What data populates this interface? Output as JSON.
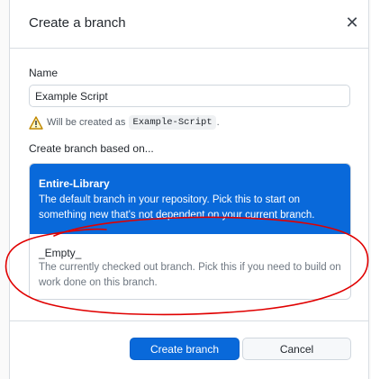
{
  "dialog": {
    "title": "Create a branch",
    "close_icon": "close-icon",
    "name_label": "Name",
    "name_value": "Example Script",
    "note": {
      "icon": "warning-icon",
      "prefix": "Will be created as",
      "code": "Example-Script",
      "suffix": "."
    },
    "based_label": "Create branch based on...",
    "options": [
      {
        "title": "Entire-Library",
        "description": "The default branch in your repository. Pick this to start on something new that's not dependent on your current branch.",
        "selected": true
      },
      {
        "title": "_Empty_",
        "description": "The currently checked out branch. Pick this if you need to build on work done on this branch.",
        "selected": false
      }
    ],
    "buttons": {
      "create": "Create branch",
      "cancel": "Cancel"
    }
  },
  "colors": {
    "accent": "#0969da",
    "warning": "#bf8700",
    "annotation": "#e00000"
  }
}
